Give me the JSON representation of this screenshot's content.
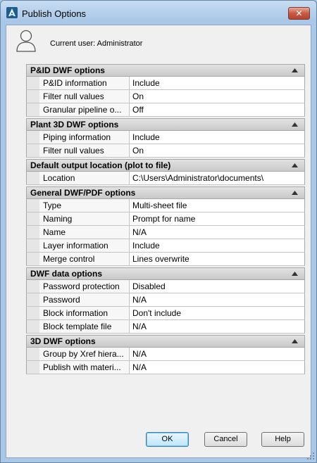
{
  "window": {
    "title": "Publish Options",
    "close_label": "✕"
  },
  "user": {
    "label": "Current user: Administrator"
  },
  "sections": [
    {
      "title": "P&ID DWF options",
      "rows": [
        {
          "name": "P&ID information",
          "value": "Include"
        },
        {
          "name": "Filter null values",
          "value": "On"
        },
        {
          "name": "Granular pipeline o...",
          "value": "Off"
        }
      ]
    },
    {
      "title": "Plant 3D DWF options",
      "rows": [
        {
          "name": "Piping information",
          "value": "Include"
        },
        {
          "name": "Filter null values",
          "value": "On"
        }
      ]
    },
    {
      "title": "Default output location (plot to file)",
      "rows": [
        {
          "name": "Location",
          "value": "C:\\Users\\Administrator\\documents\\"
        }
      ]
    },
    {
      "title": "General DWF/PDF options",
      "rows": [
        {
          "name": "Type",
          "value": "Multi-sheet file"
        },
        {
          "name": "Naming",
          "value": "Prompt for name"
        },
        {
          "name": "Name",
          "value": "N/A"
        },
        {
          "name": "Layer information",
          "value": "Include"
        },
        {
          "name": "Merge control",
          "value": "Lines overwrite"
        }
      ]
    },
    {
      "title": "DWF data options",
      "rows": [
        {
          "name": "Password protection",
          "value": "Disabled"
        },
        {
          "name": "Password",
          "value": "N/A"
        },
        {
          "name": "Block information",
          "value": "Don't include"
        },
        {
          "name": "Block template file",
          "value": "N/A"
        }
      ]
    },
    {
      "title": "3D DWF options",
      "rows": [
        {
          "name": "Group by Xref hiera...",
          "value": "N/A"
        },
        {
          "name": "Publish with materi...",
          "value": "N/A"
        }
      ]
    }
  ],
  "buttons": {
    "ok": "OK",
    "cancel": "Cancel",
    "help": "Help"
  },
  "colors": {
    "title_bar": "#a9c7e6",
    "section_header": "#d4d4d4",
    "default_button": "#bee6fd"
  },
  "icons": {
    "app": "autocad-logo-icon",
    "user": "user-silhouette-icon",
    "collapse": "collapse-up-icon",
    "close": "close-icon"
  }
}
